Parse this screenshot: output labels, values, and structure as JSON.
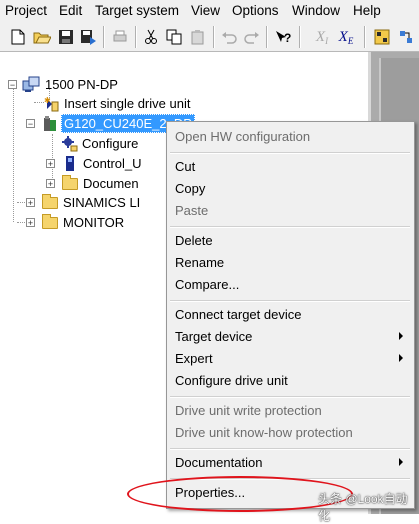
{
  "menubar": {
    "items": [
      "Project",
      "Edit",
      "Target system",
      "View",
      "Options",
      "Window",
      "Help"
    ]
  },
  "toolbar": {
    "x_label": "X",
    "x_sub": "I",
    "x2_sub": "E"
  },
  "tree": {
    "root": "1500 PN-DP",
    "insert_drive": "Insert single drive unit",
    "drive": "G120_CU240E_2_DP",
    "configure": "Configure",
    "control_unit": "Control_U",
    "documentation": "Documen",
    "sinamics": "SINAMICS LI",
    "monitor": "MONITOR"
  },
  "context_menu": {
    "open_hw": "Open HW configuration",
    "cut": "Cut",
    "copy": "Copy",
    "paste": "Paste",
    "delete": "Delete",
    "rename": "Rename",
    "compare": "Compare...",
    "connect": "Connect target device",
    "target_device": "Target device",
    "expert": "Expert",
    "configure_drive": "Configure drive unit",
    "write_protection": "Drive unit write protection",
    "knowhow_protection": "Drive unit know-how protection",
    "documentation": "Documentation",
    "properties": "Properties..."
  },
  "watermark": "头条 @Look自动化",
  "colors": {
    "highlight": "#3399ff",
    "annotation_ellipse": "#e0141c",
    "right_pane": "#ababab"
  }
}
